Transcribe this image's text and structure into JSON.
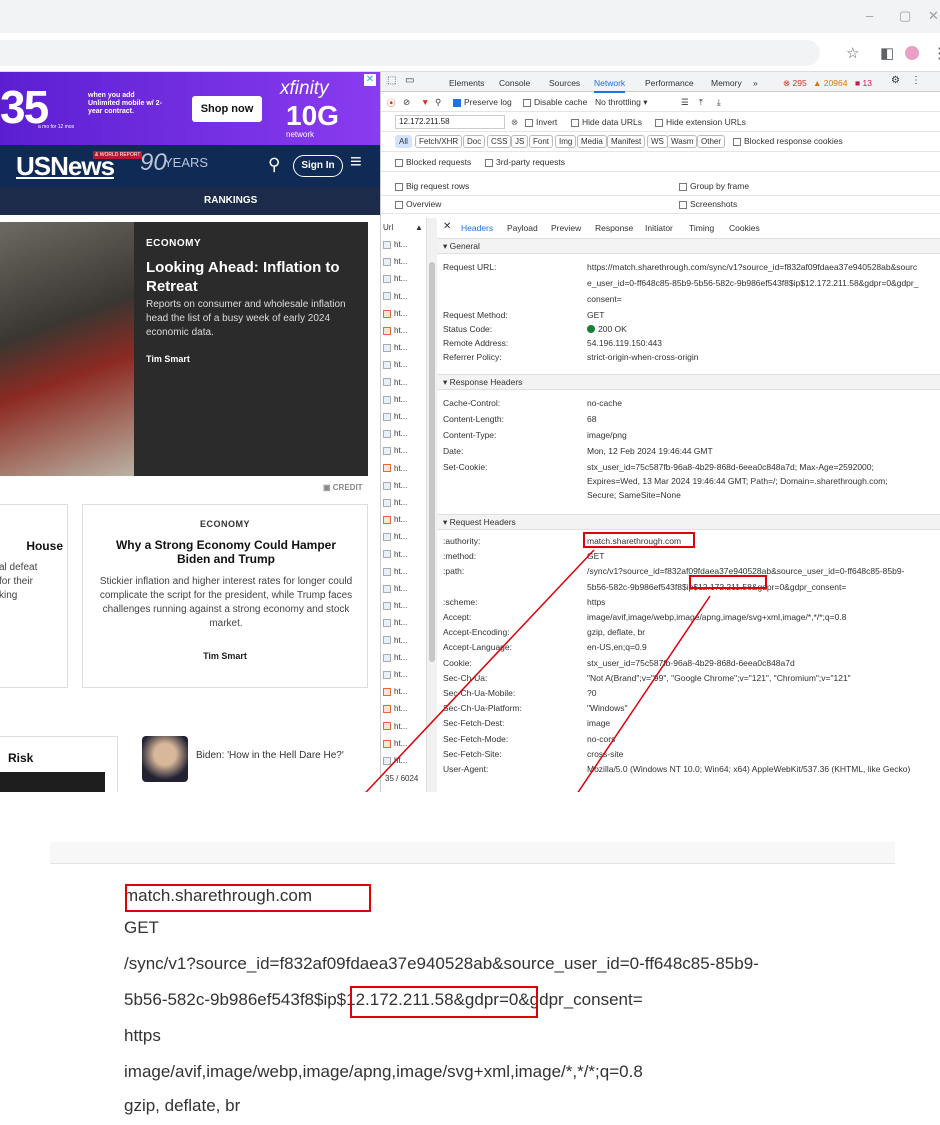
{
  "browser": {
    "window_controls": [
      "–",
      "▢",
      "✕"
    ],
    "toolbar_icons": [
      "☆",
      "◧",
      "⋮"
    ]
  },
  "ad": {
    "price": "35",
    "price_note": "a mo for 12 mos",
    "text": "when you add Unlimited mobile w/ 2-year contract.",
    "button": "Shop now",
    "brand": "xfinity",
    "speed": "10G",
    "network": "network"
  },
  "site": {
    "logo": "USNews",
    "logo_sub": "& WORLD REPORT",
    "years": "YEARS",
    "years_num": "90",
    "signin": "Sign In",
    "nav_item": "RANKINGS"
  },
  "hero": {
    "category": "ECONOMY",
    "title": "Looking Ahead: Inflation to Retreat",
    "desc": "Reports on consumer and wholesale inflation head the list of a busy week of early 2024 economic data.",
    "byline": "Tim Smart",
    "credit": "CREDIT"
  },
  "card_left": {
    "title": "House",
    "lines": [
      "al defeat",
      "for their",
      "king"
    ]
  },
  "card_right": {
    "category": "ECONOMY",
    "title": "Why a Strong Economy Could Hamper Biden and Trump",
    "desc": "Stickier inflation and higher interest rates for longer could complicate the script for the president, while Trump faces challenges running against a strong economy and stock market.",
    "byline": "Tim Smart"
  },
  "bottom": {
    "risk": "Risk",
    "biden_headline": "Biden: 'How in the Hell Dare He?'"
  },
  "devtools": {
    "tabs": [
      "Elements",
      "Console",
      "Sources",
      "Network",
      "Performance",
      "Memory",
      "»"
    ],
    "counts": {
      "errors": "295",
      "warnings": "20964",
      "info": "13"
    },
    "toolbar": {
      "preserve_log": "Preserve log",
      "disable_cache": "Disable cache",
      "throttle": "No throttling"
    },
    "filter_value": "12.172.211.58",
    "filter_opts": [
      "Invert",
      "Hide data URLs",
      "Hide extension URLs"
    ],
    "chips": [
      "All",
      "Fetch/XHR",
      "Doc",
      "CSS",
      "JS",
      "Font",
      "Img",
      "Media",
      "Manifest",
      "WS",
      "Wasm",
      "Other"
    ],
    "blocked_cookies": "Blocked response cookies",
    "blocked_requests": "Blocked requests",
    "third_party": "3rd-party requests",
    "big_rows": "Big request rows",
    "group_by_frame": "Group by frame",
    "overview": "Overview",
    "screenshots": "Screenshots",
    "url_header": "Url",
    "url_items": [
      "ht...",
      "ht...",
      "ht...",
      "ht...",
      "ht...",
      "ht...",
      "ht...",
      "ht...",
      "ht...",
      "ht...",
      "ht...",
      "ht...",
      "ht...",
      "ht...",
      "ht...",
      "ht...",
      "ht...",
      "ht...",
      "ht...",
      "ht...",
      "ht...",
      "ht...",
      "ht...",
      "ht...",
      "ht...",
      "ht...",
      "ht...",
      "ht...",
      "ht...",
      "ht...",
      "ht..."
    ],
    "status_count": "35 / 6024",
    "detail_tabs": [
      "Headers",
      "Payload",
      "Preview",
      "Response",
      "Initiator",
      "Timing",
      "Cookies"
    ],
    "general": {
      "title": "General",
      "url_key": "Request URL:",
      "url_val": [
        "https://match.sharethrough.com/sync/v1?source_id=f832af09fdaea37e940528ab&sourc",
        "e_user_id=0-ff648c85-85b9-5b56-582c-9b986ef543f8$ip$12.172.211.58&gdpr=0&gdpr_",
        "consent="
      ],
      "method_key": "Request Method:",
      "method_val": "GET",
      "status_key": "Status Code:",
      "status_val": "200 OK",
      "remote_key": "Remote Address:",
      "remote_val": "54.196.119.150:443",
      "referrer_key": "Referrer Policy:",
      "referrer_val": "strict-origin-when-cross-origin"
    },
    "response_headers": {
      "title": "Response Headers",
      "rows": [
        {
          "k": "Cache-Control:",
          "v": "no-cache"
        },
        {
          "k": "Content-Length:",
          "v": "68"
        },
        {
          "k": "Content-Type:",
          "v": "image/png"
        },
        {
          "k": "Date:",
          "v": "Mon, 12 Feb 2024 19:46:44 GMT"
        },
        {
          "k": "Set-Cookie:",
          "v": "stx_user_id=75c587fb-96a8-4b29-868d-6eea0c848a7d; Max-Age=2592000;"
        }
      ],
      "cookie_cont": [
        "Expires=Wed, 13 Mar 2024 19:46:44 GMT; Path=/; Domain=.sharethrough.com;",
        "Secure; SameSite=None"
      ]
    },
    "request_headers": {
      "title": "Request Headers",
      "rows": [
        {
          "k": ":authority:",
          "v": "match.sharethrough.com"
        },
        {
          "k": ":method:",
          "v": "GET"
        },
        {
          "k": ":path:",
          "v": "/sync/v1?source_id=f832af09fdaea37e940528ab&source_user_id=0-ff648c85-85b9-"
        },
        {
          "k": "",
          "v": "5b56-582c-9b986ef543f8$ip$12.172.211.58&gdpr=0&gdpr_consent="
        },
        {
          "k": ":scheme:",
          "v": "https"
        },
        {
          "k": "Accept:",
          "v": "image/avif,image/webp,image/apng,image/svg+xml,image/*,*/*;q=0.8"
        },
        {
          "k": "Accept-Encoding:",
          "v": "gzip, deflate, br"
        },
        {
          "k": "Accept-Language:",
          "v": "en-US,en;q=0.9"
        },
        {
          "k": "Cookie:",
          "v": "stx_user_id=75c587fb-96a8-4b29-868d-6eea0c848a7d"
        },
        {
          "k": "Sec-Ch-Ua:",
          "v": "\"Not A(Brand\";v=\"99\", \"Google Chrome\";v=\"121\", \"Chromium\";v=\"121\""
        },
        {
          "k": "Sec-Ch-Ua-Mobile:",
          "v": "?0"
        },
        {
          "k": "Sec-Ch-Ua-Platform:",
          "v": "\"Windows\""
        },
        {
          "k": "Sec-Fetch-Dest:",
          "v": "image"
        },
        {
          "k": "Sec-Fetch-Mode:",
          "v": "no-cors"
        },
        {
          "k": "Sec-Fetch-Site:",
          "v": "cross-site"
        },
        {
          "k": "User-Agent:",
          "v": "Mozilla/5.0 (Windows NT 10.0; Win64; x64) AppleWebKit/537.36 (KHTML, like Gecko)"
        }
      ]
    }
  },
  "zoom": {
    "lines": [
      "match.sharethrough.com",
      "GET",
      "/sync/v1?source_id=f832af09fdaea37e940528ab&source_user_id=0-ff648c85-85b9-",
      "5b56-582c-9b986ef543f8$ip$12.172.211.58&gdpr=0&gdpr_consent=",
      "https",
      "image/avif,image/webp,image/apng,image/svg+xml,image/*,*/*;q=0.8",
      "gzip, deflate, br"
    ]
  },
  "colors": {
    "highlight": "#e0000a",
    "nav": "#0e2a55",
    "accent": "#1a73e8"
  }
}
